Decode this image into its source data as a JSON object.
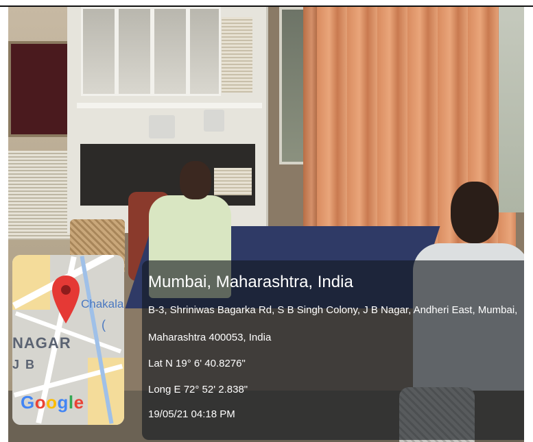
{
  "overlay": {
    "title": "Mumbai, Maharashtra, India",
    "address_line1": "B-3, Shriniwas Bagarka Rd, S B Singh Colony, J B Nagar, Andheri East, Mumbai,",
    "address_line2": "Maharashtra 400053, India",
    "latitude": "Lat N 19° 6' 40.8276\"",
    "longitude": "Long E 72° 52' 2.838\"",
    "timestamp": "19/05/21 04:18 PM"
  },
  "map": {
    "label_place": "Chakala",
    "label_paren": "(",
    "label_nagar": "NAGAR",
    "label_jb": "J B",
    "logo_letters": [
      "G",
      "o",
      "o",
      "g",
      "l",
      "e"
    ],
    "logo_colors": [
      "#4285F4",
      "#EA4335",
      "#FBBC05",
      "#4285F4",
      "#34A853",
      "#EA4335"
    ],
    "pin_color": "#E53935"
  },
  "colors": {
    "overlay_bg": "rgba(20,24,30,0.62)",
    "text": "#ffffff"
  }
}
